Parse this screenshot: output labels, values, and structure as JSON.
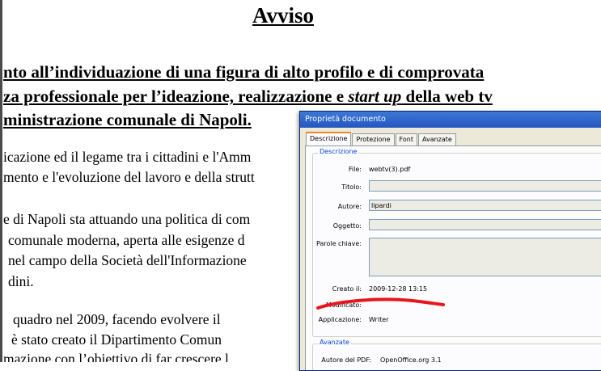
{
  "document": {
    "title": "Avviso",
    "heading_lines": [
      "nto all’individuazione di una figura di alto profilo e di comprovata",
      "za professionale per l’ideazione, realizzazione e ",
      "start up",
      " della web tv",
      "ministrazione comunale di Napoli."
    ],
    "body_lines": [
      "icazione ed il legame tra i cittadini e l'Amm",
      "mento e l'evoluzione del lavoro e della strutt",
      "e di Napoli sta attuando una politica di com",
      "comunale moderna, aperta alle esigenze d",
      "nel campo della Società dell'Informazione",
      "dini.",
      "quadro nel 2009, facendo evolvere il",
      "è stato creato il Dipartimento Comun",
      "mazione con l’obiettivo di far crescere l"
    ]
  },
  "dialog": {
    "title": "Proprietà documento",
    "tabs": [
      "Descrizione",
      "Protezione",
      "Font",
      "Avanzate"
    ],
    "description_group": "Descrizione",
    "labels": {
      "file": "File:",
      "titolo": "Titolo:",
      "autore": "Autore:",
      "oggetto": "Oggetto:",
      "parole_chiave": "Parole chiave:",
      "creato": "Creato il:",
      "modificato": "Modificato:",
      "applicazione": "Applicazione:"
    },
    "values": {
      "file": "webtv(3).pdf",
      "titolo": "",
      "autore": "lipardi",
      "oggetto": "",
      "parole_chiave": "",
      "creato": "2009-12-28 13:15",
      "applicazione": "Writer"
    },
    "advanced_group": "Avanzate",
    "advanced": {
      "autore_pdf_label": "Autore del PDF:",
      "autore_pdf_value": "OpenOffice.org 3.1"
    }
  },
  "colors": {
    "annotation_stroke": "#e8161b",
    "titlebar": "#2f66cc",
    "group_label": "#0046d5"
  }
}
